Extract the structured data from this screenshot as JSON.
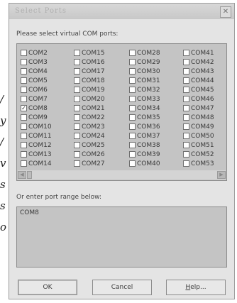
{
  "window": {
    "title": "Select Ports",
    "close_glyph": "✕"
  },
  "prompt": "Please select virtual COM ports:",
  "ports": {
    "columns": [
      [
        {
          "label": "COM2",
          "checked": false
        },
        {
          "label": "COM3",
          "checked": false
        },
        {
          "label": "COM4",
          "checked": false
        },
        {
          "label": "COM5",
          "checked": false
        },
        {
          "label": "COM6",
          "checked": false
        },
        {
          "label": "COM7",
          "checked": false
        },
        {
          "label": "COM8",
          "checked": true
        },
        {
          "label": "COM9",
          "checked": false
        },
        {
          "label": "COM10",
          "checked": false
        },
        {
          "label": "COM11",
          "checked": false
        },
        {
          "label": "COM12",
          "checked": false
        },
        {
          "label": "COM13",
          "checked": false
        },
        {
          "label": "COM14",
          "checked": false
        }
      ],
      [
        {
          "label": "COM15",
          "checked": false
        },
        {
          "label": "COM16",
          "checked": false
        },
        {
          "label": "COM17",
          "checked": false
        },
        {
          "label": "COM18",
          "checked": false
        },
        {
          "label": "COM19",
          "checked": false
        },
        {
          "label": "COM20",
          "checked": false
        },
        {
          "label": "COM21",
          "checked": false
        },
        {
          "label": "COM22",
          "checked": false
        },
        {
          "label": "COM23",
          "checked": false
        },
        {
          "label": "COM24",
          "checked": false
        },
        {
          "label": "COM25",
          "checked": false
        },
        {
          "label": "COM26",
          "checked": false
        },
        {
          "label": "COM27",
          "checked": false
        }
      ],
      [
        {
          "label": "COM28",
          "checked": false
        },
        {
          "label": "COM29",
          "checked": false
        },
        {
          "label": "COM30",
          "checked": false
        },
        {
          "label": "COM31",
          "checked": false
        },
        {
          "label": "COM32",
          "checked": false
        },
        {
          "label": "COM33",
          "checked": false
        },
        {
          "label": "COM34",
          "checked": false
        },
        {
          "label": "COM35",
          "checked": false
        },
        {
          "label": "COM36",
          "checked": false
        },
        {
          "label": "COM37",
          "checked": false
        },
        {
          "label": "COM38",
          "checked": false
        },
        {
          "label": "COM39",
          "checked": false
        },
        {
          "label": "COM40",
          "checked": false
        }
      ],
      [
        {
          "label": "COM41",
          "checked": false
        },
        {
          "label": "COM42",
          "checked": false
        },
        {
          "label": "COM43",
          "checked": false
        },
        {
          "label": "COM44",
          "checked": false
        },
        {
          "label": "COM45",
          "checked": false
        },
        {
          "label": "COM46",
          "checked": false
        },
        {
          "label": "COM47",
          "checked": false
        },
        {
          "label": "COM48",
          "checked": false
        },
        {
          "label": "COM49",
          "checked": false
        },
        {
          "label": "COM50",
          "checked": false
        },
        {
          "label": "COM51",
          "checked": false
        },
        {
          "label": "COM52",
          "checked": false
        },
        {
          "label": "COM53",
          "checked": false
        }
      ]
    ],
    "check_glyph": "✓",
    "scroll_left_glyph": "◀",
    "scroll_right_glyph": "▶"
  },
  "range": {
    "label": "Or enter port range below:",
    "value": "COM8"
  },
  "buttons": {
    "ok": "OK",
    "cancel": "Cancel",
    "help_mnemonic": "H",
    "help_rest": "elp..."
  },
  "left_edge_text": [
    "/",
    "y",
    "/",
    "v",
    "s",
    "s",
    "o"
  ],
  "colors": {
    "dialog_bg": "#e4e4e4",
    "box_bg": "#c4c4c4"
  }
}
